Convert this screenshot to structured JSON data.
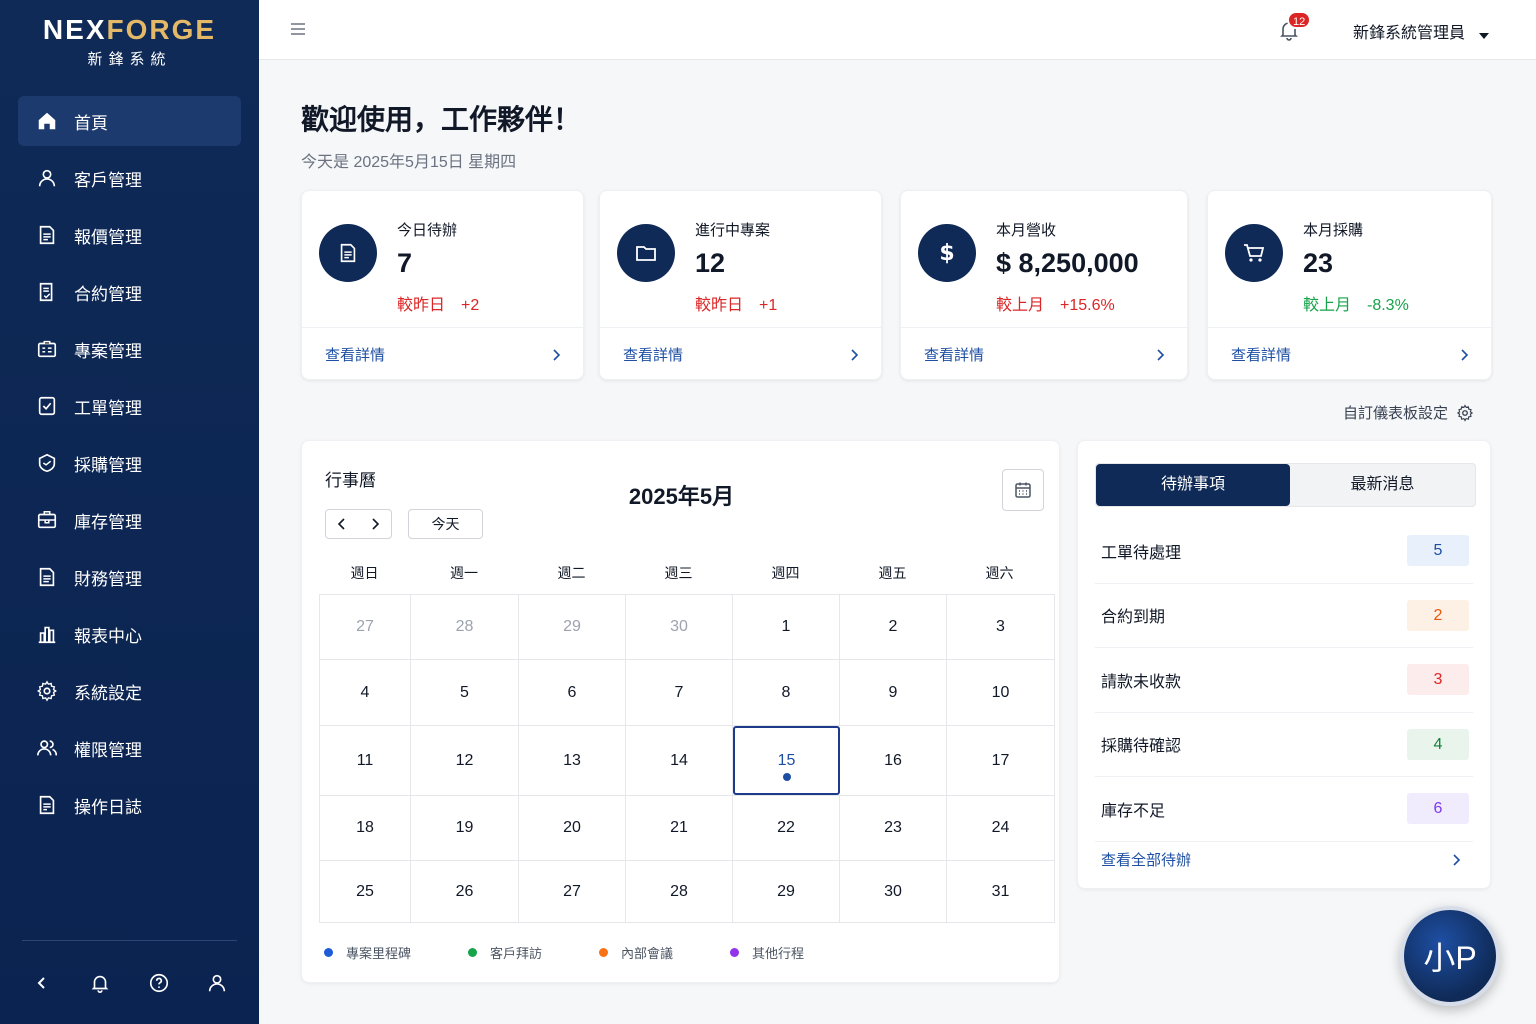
{
  "brand": {
    "name_part1": "NEX",
    "name_part2": "FORGE",
    "subtitle": "新鋒系統"
  },
  "sidebar": {
    "items": [
      {
        "label": "首頁",
        "icon": "home-icon",
        "active": true
      },
      {
        "label": "客戶管理",
        "icon": "user-icon"
      },
      {
        "label": "報價管理",
        "icon": "document-icon"
      },
      {
        "label": "合約管理",
        "icon": "contract-icon"
      },
      {
        "label": "專案管理",
        "icon": "project-icon"
      },
      {
        "label": "工單管理",
        "icon": "workorder-icon"
      },
      {
        "label": "採購管理",
        "icon": "purchase-icon"
      },
      {
        "label": "庫存管理",
        "icon": "inventory-icon"
      },
      {
        "label": "財務管理",
        "icon": "finance-icon"
      },
      {
        "label": "報表中心",
        "icon": "report-icon"
      },
      {
        "label": "系統設定",
        "icon": "gear-icon"
      },
      {
        "label": "權限管理",
        "icon": "users-icon"
      },
      {
        "label": "操作日誌",
        "icon": "log-icon"
      }
    ],
    "footer_icons": [
      "chevron-left-icon",
      "bell-icon",
      "help-icon",
      "user-icon"
    ]
  },
  "topbar": {
    "notification_count": "12",
    "user_name": "新鋒系統管理員"
  },
  "welcome": {
    "title": "歡迎使用，工作夥伴！",
    "date": "今天是 2025年5月15日 星期四"
  },
  "stats": [
    {
      "title": "今日待辦",
      "value": "7",
      "delta": "較昨日　+2",
      "trend": "up",
      "link": "查看詳情",
      "icon": "document-icon"
    },
    {
      "title": "進行中專案",
      "value": "12",
      "delta": "較昨日　+1",
      "trend": "up",
      "link": "查看詳情",
      "icon": "folder-icon"
    },
    {
      "title": "本月營收",
      "value": "$ 8,250,000",
      "delta": "較上月　+15.6%",
      "trend": "up",
      "link": "查看詳情",
      "icon": "dollar-icon"
    },
    {
      "title": "本月採購",
      "value": "23",
      "delta": "較上月　-8.3%",
      "trend": "down",
      "link": "查看詳情",
      "icon": "cart-icon"
    }
  ],
  "dashboard_settings": "自訂儀表板設定",
  "calendar": {
    "title": "行事曆",
    "month": "2025年5月",
    "today_label": "今天",
    "weekdays": [
      "週日",
      "週一",
      "週二",
      "週三",
      "週四",
      "週五",
      "週六"
    ],
    "weeks": [
      [
        "27",
        "28",
        "29",
        "30",
        "1",
        "2",
        "3"
      ],
      [
        "4",
        "5",
        "6",
        "7",
        "8",
        "9",
        "10"
      ],
      [
        "11",
        "12",
        "13",
        "14",
        "15",
        "16",
        "17"
      ],
      [
        "18",
        "19",
        "20",
        "21",
        "22",
        "23",
        "24"
      ],
      [
        "25",
        "26",
        "27",
        "28",
        "29",
        "30",
        "31"
      ]
    ],
    "today": "15",
    "legend": [
      {
        "label": "專案里程碑",
        "color": "#1e5bd8"
      },
      {
        "label": "客戶拜訪",
        "color": "#16a34a"
      },
      {
        "label": "內部會議",
        "color": "#f97316"
      },
      {
        "label": "其他行程",
        "color": "#9333ea"
      }
    ]
  },
  "todo_panel": {
    "tabs": [
      "待辦事項",
      "最新消息"
    ],
    "items": [
      {
        "label": "工單待處理",
        "count": "5",
        "color": "#1e4fa3",
        "bg": "#e8f0fb"
      },
      {
        "label": "合約到期",
        "count": "2",
        "color": "#ea580c",
        "bg": "#fdf0e4"
      },
      {
        "label": "請款未收款",
        "count": "3",
        "color": "#dc2626",
        "bg": "#fdecec"
      },
      {
        "label": "採購待確認",
        "count": "4",
        "color": "#15803d",
        "bg": "#e9f5ec"
      },
      {
        "label": "庫存不足",
        "count": "6",
        "color": "#7c3aed",
        "bg": "#f1ecfd"
      }
    ],
    "view_all": "查看全部待辦"
  },
  "assistant": {
    "label": "小P"
  }
}
